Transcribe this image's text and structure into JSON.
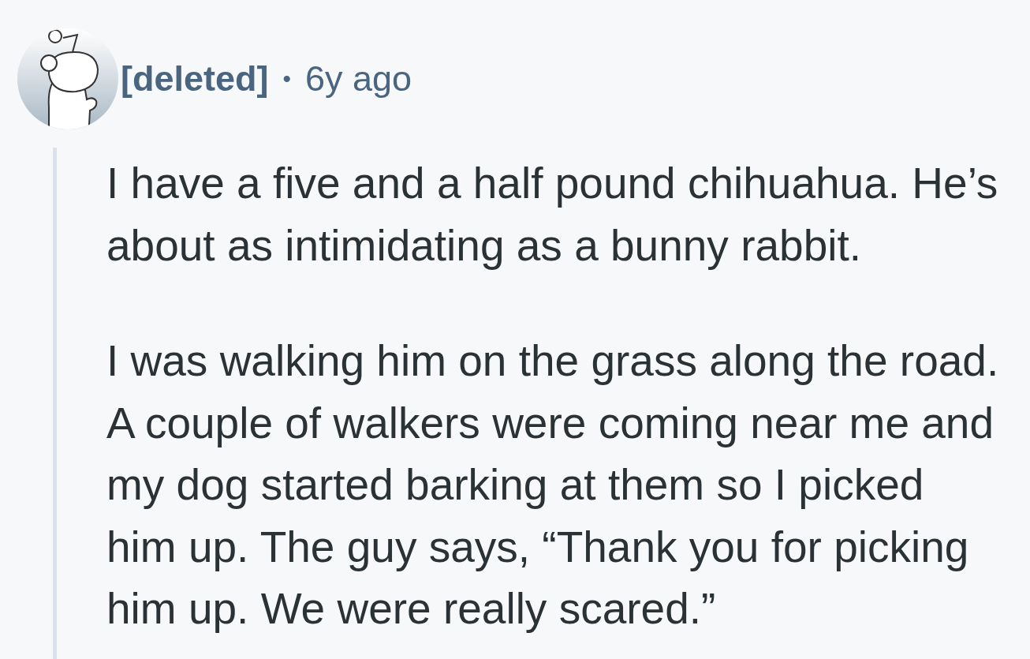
{
  "comment": {
    "author": "[deleted]",
    "separator": "•",
    "age": "6y ago",
    "paragraphs": [
      "I have a five and a half pound chihuahua. He’s about as intimidating as a bunny rabbit.",
      "I was walking him on the grass along the road. A couple of walkers were coming near me and my dog started barking at them so I picked him up. The guy says, “Thank you for picking him up. We were really scared.”"
    ]
  }
}
